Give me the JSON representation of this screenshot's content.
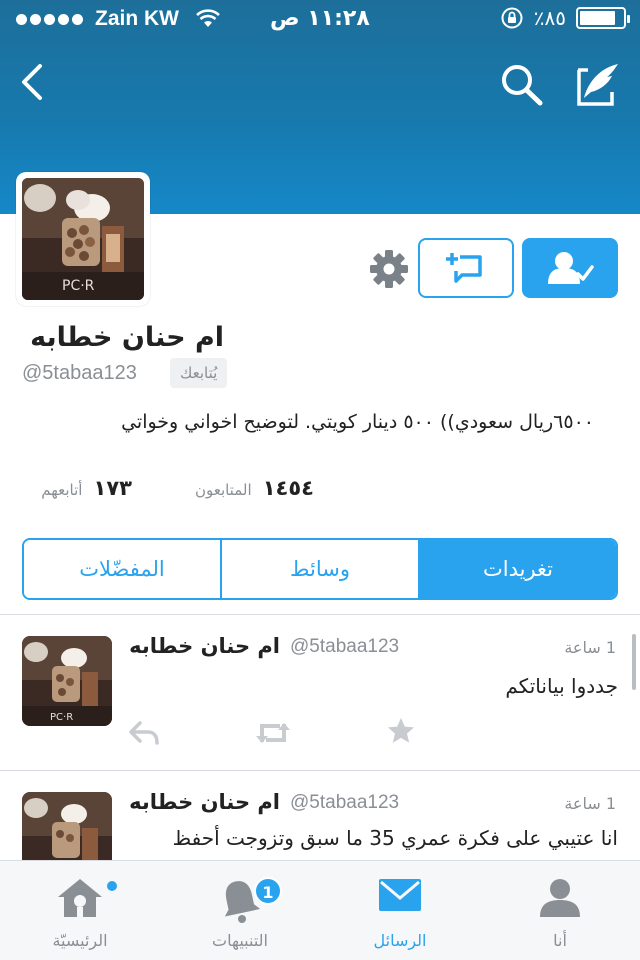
{
  "status_bar": {
    "carrier": "Zain KW",
    "time": "١١:٢٨ ص",
    "battery": "٪٨٥",
    "battery_level": 0.85
  },
  "nav": {
    "back_icon": "chevron-left-icon",
    "search_icon": "search-icon",
    "compose_icon": "compose-icon"
  },
  "profile": {
    "name": "ام حنان خطابه",
    "handle": "@5tabaa123",
    "follows_you": "يُتابعك",
    "bio": "٦٥٠٠ريال سعودي)) ٥٠٠ دينار كويتي. لتوضيح اخواني وخواتي",
    "followers_count": "١٤٥٤",
    "followers_label": "المتابعون",
    "following_count": "١٧٣",
    "following_label": "أتابعهم"
  },
  "actions": {
    "settings_icon": "gear-icon",
    "message_icon": "direct-message-icon",
    "follow_icon": "following-user-icon"
  },
  "tabs": [
    {
      "label": "المفضّلات",
      "active": false
    },
    {
      "label": "وسائط",
      "active": false
    },
    {
      "label": "تغريدات",
      "active": true
    }
  ],
  "tweets": [
    {
      "name": "ام حنان خطابه",
      "handle": "@5tabaa123",
      "time": "1 ساعة",
      "text": "جددوا بياناتكم"
    },
    {
      "name": "ام حنان خطابه",
      "handle": "@5tabaa123",
      "time": "1 ساعة",
      "text": "انا عتيبي على فكرة عمري 35 ما سبق وتزوجت أحفظ"
    }
  ],
  "tabbar": [
    {
      "label": "الرئيسيّة",
      "icon": "home-icon",
      "active": false,
      "dot": true
    },
    {
      "label": "التنبيهات",
      "icon": "bell-icon",
      "active": false,
      "badge": "1"
    },
    {
      "label": "الرسائل",
      "icon": "envelope-icon",
      "active": true
    },
    {
      "label": "أنا",
      "icon": "person-icon",
      "active": false
    }
  ],
  "colors": {
    "accent": "#2aa3ef",
    "header_dark": "#1d6f9a",
    "header_light": "#1688c8"
  }
}
